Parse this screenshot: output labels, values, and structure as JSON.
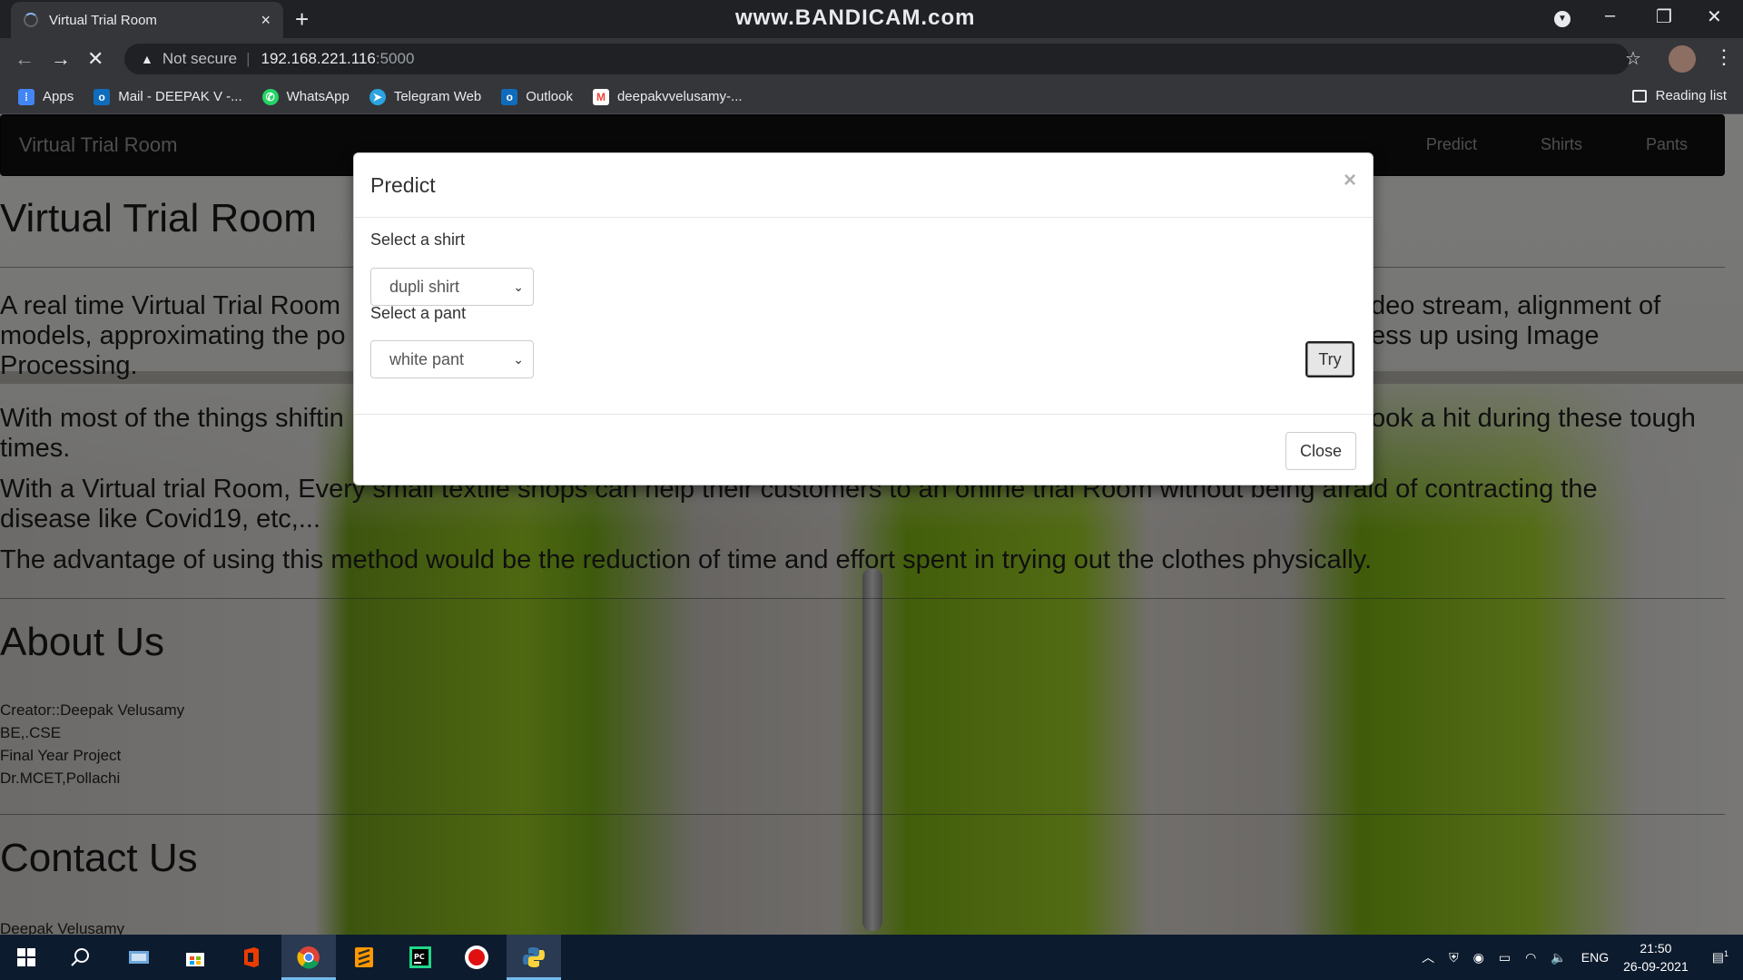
{
  "browser": {
    "tab_title": "Virtual Trial Room",
    "tab_close": "×",
    "new_tab": "+",
    "watermark": "www.BANDICAM.com",
    "not_secure": "Not secure",
    "url_host": "192.168.221.116",
    "url_port": ":5000",
    "bookmarks": [
      {
        "label": "Apps",
        "icon": "apps-grid-icon",
        "color": "#4285f4"
      },
      {
        "label": "Mail - DEEPAK V -...",
        "icon": "outlook-mail-icon",
        "color": "#0f6cbd"
      },
      {
        "label": "WhatsApp",
        "icon": "whatsapp-icon",
        "color": "#25d366"
      },
      {
        "label": "Telegram Web",
        "icon": "telegram-icon",
        "color": "#2aa3df"
      },
      {
        "label": "Outlook",
        "icon": "outlook-icon",
        "color": "#0f6cbd"
      },
      {
        "label": "deepakvvelusamy-...",
        "icon": "gmail-icon",
        "color": "#ea4335"
      }
    ],
    "reading_list": "Reading list"
  },
  "navbar": {
    "brand": "Virtual Trial Room",
    "links": [
      "Predict",
      "Shirts",
      "Pants"
    ]
  },
  "page": {
    "title": "Virtual Trial Room",
    "p1_line1_left": "A real time Virtual Trial Room",
    "p1_line1_right": "deo stream, alignment of",
    "p1_line2_left": "models, approximating the po",
    "p1_line2_right": "ess up using Image",
    "p1_line3": "Processing.",
    "p2_line1_left": "With most of the things shiftin",
    "p2_line1_right": "ook a hit during these tough",
    "p2_line2": "times.",
    "p3_line1": "With a Virtual trial Room, Every small textile shops can help their customers to an online trial Room without being afraid of contracting the",
    "p3_line2": "disease like Covid19, etc,...",
    "p4": "The advantage of using this method would be the reduction of time and effort spent in trying out the clothes physically.",
    "about_heading": "About Us",
    "about_lines": [
      "Creator::Deepak Velusamy",
      "BE,.CSE",
      "Final Year Project",
      "Dr.MCET,Pollachi"
    ],
    "contact_heading": "Contact Us",
    "contact_name": "Deepak Velusamy"
  },
  "modal": {
    "title": "Predict",
    "close_x": "×",
    "shirt_label": "Select a shirt",
    "shirt_selected": "dupli shirt",
    "pant_label": "Select a pant",
    "pant_selected": "white pant",
    "try_label": "Try",
    "close_label": "Close"
  },
  "taskbar": {
    "language": "ENG",
    "time": "21:50",
    "date": "26-09-2021",
    "notification_count": "1"
  }
}
